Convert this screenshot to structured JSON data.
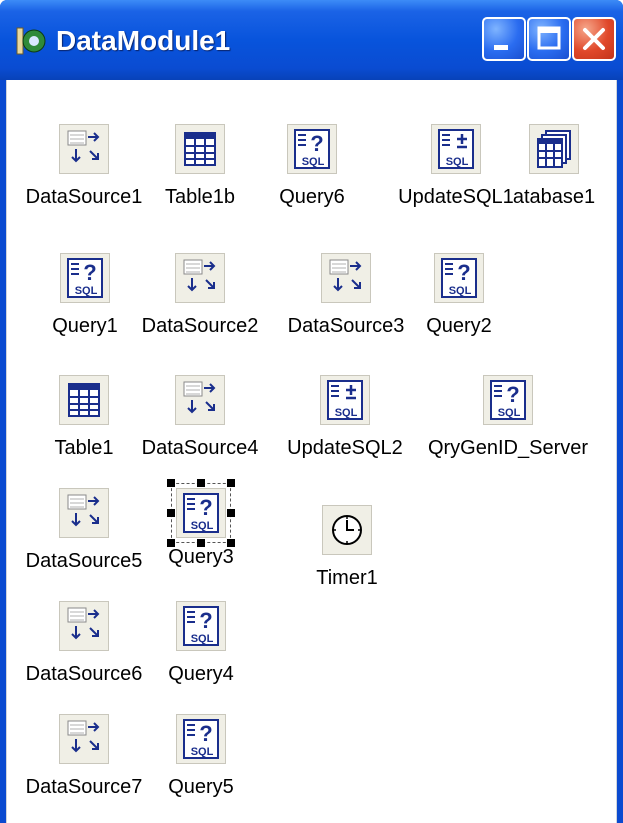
{
  "window": {
    "title": "DataModule1"
  },
  "components": [
    {
      "id": "datasource1",
      "label": "DataSource1",
      "type": "datasource"
    },
    {
      "id": "table1b",
      "label": "Table1b",
      "type": "table"
    },
    {
      "id": "query6",
      "label": "Query6",
      "type": "query"
    },
    {
      "id": "updatesql1",
      "label": "UpdateSQL1",
      "type": "updatesql"
    },
    {
      "id": "database1",
      "label": "atabase1",
      "type": "database"
    },
    {
      "id": "query1",
      "label": "Query1",
      "type": "query"
    },
    {
      "id": "datasource2",
      "label": "DataSource2",
      "type": "datasource"
    },
    {
      "id": "datasource3",
      "label": "DataSource3",
      "type": "datasource"
    },
    {
      "id": "query2",
      "label": "Query2",
      "type": "query"
    },
    {
      "id": "table1",
      "label": "Table1",
      "type": "table"
    },
    {
      "id": "datasource4",
      "label": "DataSource4",
      "type": "datasource"
    },
    {
      "id": "updatesql2",
      "label": "UpdateSQL2",
      "type": "updatesql"
    },
    {
      "id": "qrygenid",
      "label": "QryGenID_Server",
      "type": "query"
    },
    {
      "id": "datasource5",
      "label": "DataSource5",
      "type": "datasource"
    },
    {
      "id": "query3",
      "label": "Query3",
      "type": "query",
      "selected": true
    },
    {
      "id": "timer1",
      "label": "Timer1",
      "type": "timer"
    },
    {
      "id": "datasource6",
      "label": "DataSource6",
      "type": "datasource"
    },
    {
      "id": "query4",
      "label": "Query4",
      "type": "query"
    },
    {
      "id": "datasource7",
      "label": "DataSource7",
      "type": "datasource"
    },
    {
      "id": "query5",
      "label": "Query5",
      "type": "query"
    }
  ],
  "icons": {
    "app": "delphi-icon",
    "minimize": "minimize-icon",
    "maximize": "maximize-icon",
    "close": "close-icon",
    "datasource": "datasource-icon",
    "table": "table-icon",
    "query": "query-sql-icon",
    "updatesql": "updatesql-icon",
    "database": "database-icon",
    "timer": "timer-icon"
  },
  "icon_text": {
    "sql": "SQL"
  },
  "colors": {
    "titlebar": "#0854dc",
    "close": "#e0482a",
    "icon_bg": "#f0efe6",
    "icon_blue": "#1a2e8c"
  }
}
